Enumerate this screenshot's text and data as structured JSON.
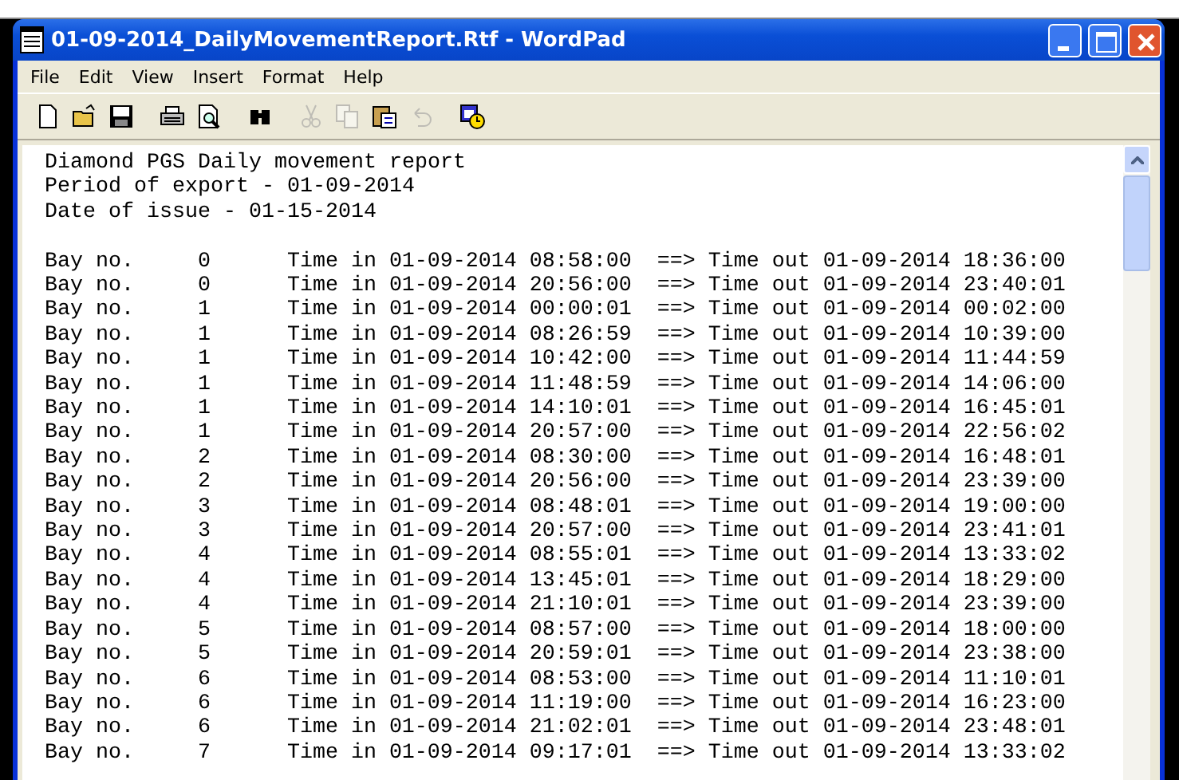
{
  "window": {
    "title": "01-09-2014_DailyMovementReport.Rtf - WordPad"
  },
  "menu": [
    "File",
    "Edit",
    "View",
    "Insert",
    "Format",
    "Help"
  ],
  "toolbar": [
    {
      "kind": "new",
      "disabled": false
    },
    {
      "kind": "open",
      "disabled": false
    },
    {
      "kind": "save",
      "disabled": false
    },
    {
      "kind": "sep"
    },
    {
      "kind": "print",
      "disabled": false
    },
    {
      "kind": "preview",
      "disabled": false
    },
    {
      "kind": "sep"
    },
    {
      "kind": "find",
      "disabled": false
    },
    {
      "kind": "sep"
    },
    {
      "kind": "cut",
      "disabled": true
    },
    {
      "kind": "copy",
      "disabled": true
    },
    {
      "kind": "paste",
      "disabled": false
    },
    {
      "kind": "undo",
      "disabled": true
    },
    {
      "kind": "sep"
    },
    {
      "kind": "datetime",
      "disabled": false
    }
  ],
  "document": {
    "header": [
      "Diamond PGS Daily movement report",
      "Period of export - 01-09-2014",
      "Date of issue - 01-15-2014"
    ],
    "rows": [
      {
        "label": "Bay no.",
        "bay": "0",
        "time_in": "Time in 01-09-2014 08:58:00",
        "arrow": "==>",
        "time_out": "Time out 01-09-2014 18:36:00"
      },
      {
        "label": "Bay no.",
        "bay": "0",
        "time_in": "Time in 01-09-2014 20:56:00",
        "arrow": "==>",
        "time_out": "Time out 01-09-2014 23:40:01"
      },
      {
        "label": "Bay no.",
        "bay": "1",
        "time_in": "Time in 01-09-2014 00:00:01",
        "arrow": "==>",
        "time_out": "Time out 01-09-2014 00:02:00"
      },
      {
        "label": "Bay no.",
        "bay": "1",
        "time_in": "Time in 01-09-2014 08:26:59",
        "arrow": "==>",
        "time_out": "Time out 01-09-2014 10:39:00"
      },
      {
        "label": "Bay no.",
        "bay": "1",
        "time_in": "Time in 01-09-2014 10:42:00",
        "arrow": "==>",
        "time_out": "Time out 01-09-2014 11:44:59"
      },
      {
        "label": "Bay no.",
        "bay": "1",
        "time_in": "Time in 01-09-2014 11:48:59",
        "arrow": "==>",
        "time_out": "Time out 01-09-2014 14:06:00"
      },
      {
        "label": "Bay no.",
        "bay": "1",
        "time_in": "Time in 01-09-2014 14:10:01",
        "arrow": "==>",
        "time_out": "Time out 01-09-2014 16:45:01"
      },
      {
        "label": "Bay no.",
        "bay": "1",
        "time_in": "Time in 01-09-2014 20:57:00",
        "arrow": "==>",
        "time_out": "Time out 01-09-2014 22:56:02"
      },
      {
        "label": "Bay no.",
        "bay": "2",
        "time_in": "Time in 01-09-2014 08:30:00",
        "arrow": "==>",
        "time_out": "Time out 01-09-2014 16:48:01"
      },
      {
        "label": "Bay no.",
        "bay": "2",
        "time_in": "Time in 01-09-2014 20:56:00",
        "arrow": "==>",
        "time_out": "Time out 01-09-2014 23:39:00"
      },
      {
        "label": "Bay no.",
        "bay": "3",
        "time_in": "Time in 01-09-2014 08:48:01",
        "arrow": "==>",
        "time_out": "Time out 01-09-2014 19:00:00"
      },
      {
        "label": "Bay no.",
        "bay": "3",
        "time_in": "Time in 01-09-2014 20:57:00",
        "arrow": "==>",
        "time_out": "Time out 01-09-2014 23:41:01"
      },
      {
        "label": "Bay no.",
        "bay": "4",
        "time_in": "Time in 01-09-2014 08:55:01",
        "arrow": "==>",
        "time_out": "Time out 01-09-2014 13:33:02"
      },
      {
        "label": "Bay no.",
        "bay": "4",
        "time_in": "Time in 01-09-2014 13:45:01",
        "arrow": "==>",
        "time_out": "Time out 01-09-2014 18:29:00"
      },
      {
        "label": "Bay no.",
        "bay": "4",
        "time_in": "Time in 01-09-2014 21:10:01",
        "arrow": "==>",
        "time_out": "Time out 01-09-2014 23:39:00"
      },
      {
        "label": "Bay no.",
        "bay": "5",
        "time_in": "Time in 01-09-2014 08:57:00",
        "arrow": "==>",
        "time_out": "Time out 01-09-2014 18:00:00"
      },
      {
        "label": "Bay no.",
        "bay": "5",
        "time_in": "Time in 01-09-2014 20:59:01",
        "arrow": "==>",
        "time_out": "Time out 01-09-2014 23:38:00"
      },
      {
        "label": "Bay no.",
        "bay": "6",
        "time_in": "Time in 01-09-2014 08:53:00",
        "arrow": "==>",
        "time_out": "Time out 01-09-2014 11:10:01"
      },
      {
        "label": "Bay no.",
        "bay": "6",
        "time_in": "Time in 01-09-2014 11:19:00",
        "arrow": "==>",
        "time_out": "Time out 01-09-2014 16:23:00"
      },
      {
        "label": "Bay no.",
        "bay": "6",
        "time_in": "Time in 01-09-2014 21:02:01",
        "arrow": "==>",
        "time_out": "Time out 01-09-2014 23:48:01"
      },
      {
        "label": "Bay no.",
        "bay": "7",
        "time_in": "Time in 01-09-2014 09:17:01",
        "arrow": "==>",
        "time_out": "Time out 01-09-2014 13:33:02"
      }
    ]
  }
}
